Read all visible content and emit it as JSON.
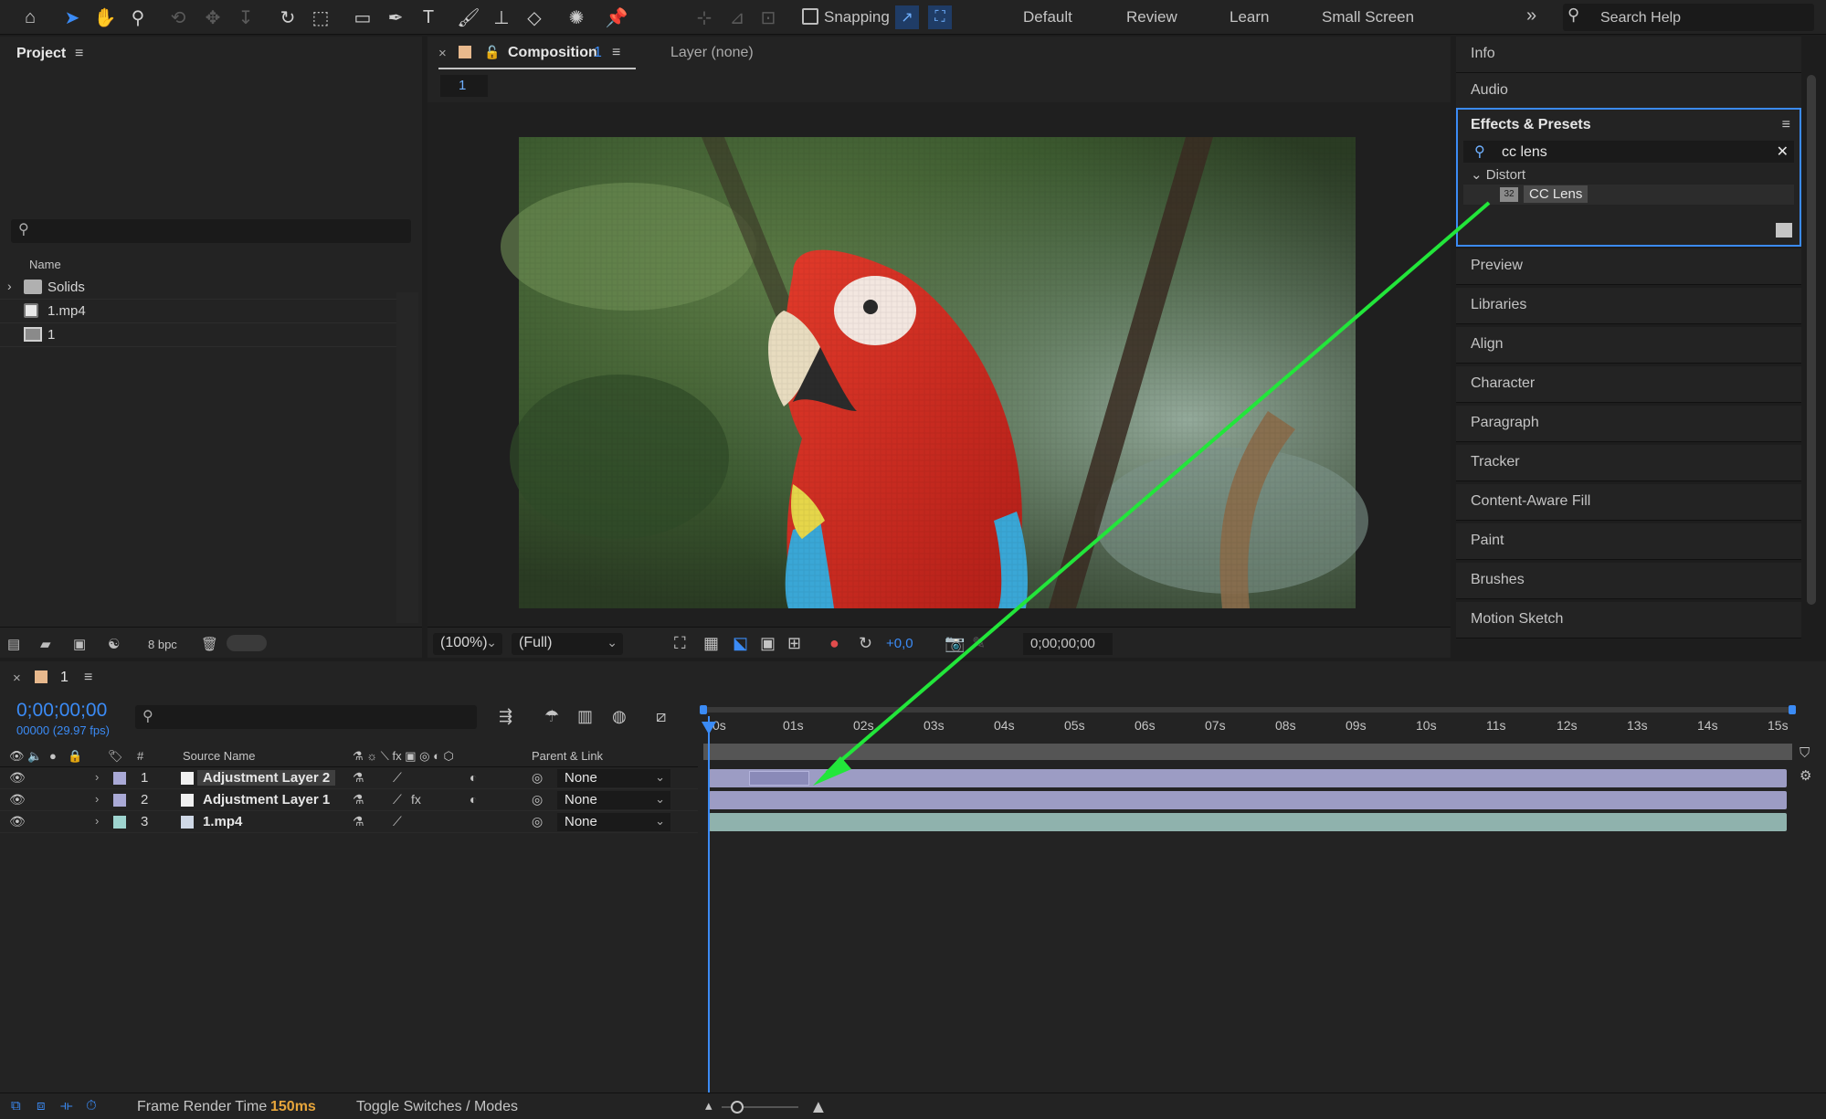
{
  "toolbar": {
    "snapping_label": "Snapping",
    "workspaces": [
      "Default",
      "Review",
      "Learn",
      "Small Screen"
    ],
    "search_help": "Search Help"
  },
  "project": {
    "title": "Project",
    "name_column": "Name",
    "items": [
      {
        "label": "Solids",
        "type": "folder"
      },
      {
        "label": "1.mp4",
        "type": "footage"
      },
      {
        "label": "1",
        "type": "composition"
      }
    ],
    "bit_depth": "8 bpc"
  },
  "composition": {
    "tab_title": "Composition",
    "tab_number": "1",
    "layer_tab": "Layer (none)",
    "breadcrumb": "1",
    "zoom": "(100%)",
    "resolution": "(Full)",
    "exposure": "+0,0",
    "timecode": "0;00;00;00"
  },
  "right_panels": {
    "top": [
      "Info",
      "Audio"
    ],
    "effects": {
      "title": "Effects & Presets",
      "search_value": "cc lens",
      "category": "Distort",
      "item_badge": "32",
      "item": "CC Lens"
    },
    "bottom": [
      "Preview",
      "Libraries",
      "Align",
      "Character",
      "Paragraph",
      "Tracker",
      "Content-Aware Fill",
      "Paint",
      "Brushes",
      "Motion Sketch"
    ]
  },
  "timeline": {
    "comp_name": "1",
    "current_time": "0;00;00;00",
    "frames": "00000 (29.97 fps)",
    "columns": {
      "number": "#",
      "source_name": "Source Name",
      "parent": "Parent & Link"
    },
    "ticks": [
      "0s",
      "01s",
      "02s",
      "03s",
      "04s",
      "05s",
      "06s",
      "07s",
      "08s",
      "09s",
      "10s",
      "11s",
      "12s",
      "13s",
      "14s",
      "15s"
    ],
    "layers": [
      {
        "number": "1",
        "name": "Adjustment Layer 2",
        "parent": "None",
        "label_color": "#a9a9d6",
        "selected": true,
        "fx": false
      },
      {
        "number": "2",
        "name": "Adjustment Layer 1",
        "parent": "None",
        "label_color": "#a9a9d6",
        "selected": false,
        "fx": true
      },
      {
        "number": "3",
        "name": "1.mp4",
        "parent": "None",
        "label_color": "#9ed4cf",
        "selected": false,
        "fx": false
      }
    ]
  },
  "status": {
    "frame_render_label": "Frame Render Time",
    "frame_render_value": "150ms",
    "toggle_label": "Toggle Switches / Modes"
  },
  "colors": {
    "accent_blue": "#3b8bf5",
    "annotation_arrow": "#22e63a",
    "adjustment_track": "#9c9cc4",
    "footage_track": "#8fb2ad"
  },
  "icons": {
    "toolbar": [
      "home-icon",
      "selection-tool-icon",
      "hand-tool-icon",
      "zoom-tool-icon",
      "orbit-camera-icon",
      "pan-camera-icon",
      "dolly-camera-icon",
      "rotation-tool-icon",
      "pan-behind-icon",
      "rectangle-tool-icon",
      "pen-tool-icon",
      "type-tool-icon",
      "brush-tool-icon",
      "clone-stamp-icon",
      "eraser-tool-icon",
      "roto-brush-icon",
      "puppet-pin-icon"
    ]
  }
}
